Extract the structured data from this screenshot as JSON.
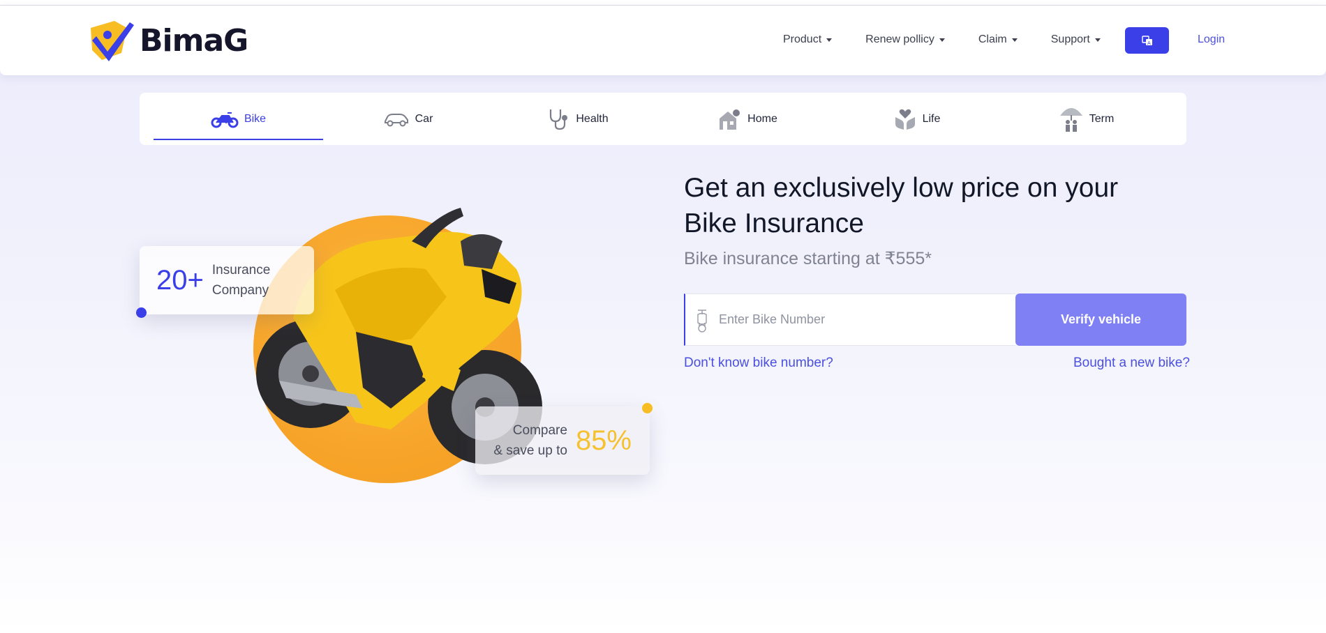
{
  "brand": {
    "name": "BimaG",
    "colors": {
      "primary": "#3b3fe8",
      "accent": "#f8bd22"
    }
  },
  "nav": {
    "items": [
      {
        "label": "Product"
      },
      {
        "label": "Renew pollicy"
      },
      {
        "label": "Claim"
      },
      {
        "label": "Support"
      }
    ],
    "language_icon": "translate-icon",
    "login_label": "Login"
  },
  "tabs": [
    {
      "label": "Bike",
      "icon": "motorbike-icon",
      "active": true
    },
    {
      "label": "Car",
      "icon": "car-icon",
      "active": false
    },
    {
      "label": "Health",
      "icon": "stethoscope-icon",
      "active": false
    },
    {
      "label": "Home",
      "icon": "house-icon",
      "active": false
    },
    {
      "label": "Life",
      "icon": "heart-hands-icon",
      "active": false
    },
    {
      "label": "Term",
      "icon": "umbrella-family-icon",
      "active": false
    }
  ],
  "stats": {
    "insurers": {
      "value": "20+",
      "line1": "Insurance",
      "line2": "Company"
    },
    "savings": {
      "line1": "Compare",
      "line2": "& save up to",
      "value": "85%"
    }
  },
  "hero": {
    "title_line1": "Get an exclusively low price on your",
    "title_line2": "Bike Insurance",
    "subtitle": "Bike insurance starting at ₹555*"
  },
  "search": {
    "placeholder": "Enter Bike Number",
    "value": "",
    "button_label": "Verify vehicle",
    "icon": "scooter-icon"
  },
  "links": {
    "unknown_number": "Don't know bike number?",
    "new_bike": "Bought a new bike?"
  }
}
